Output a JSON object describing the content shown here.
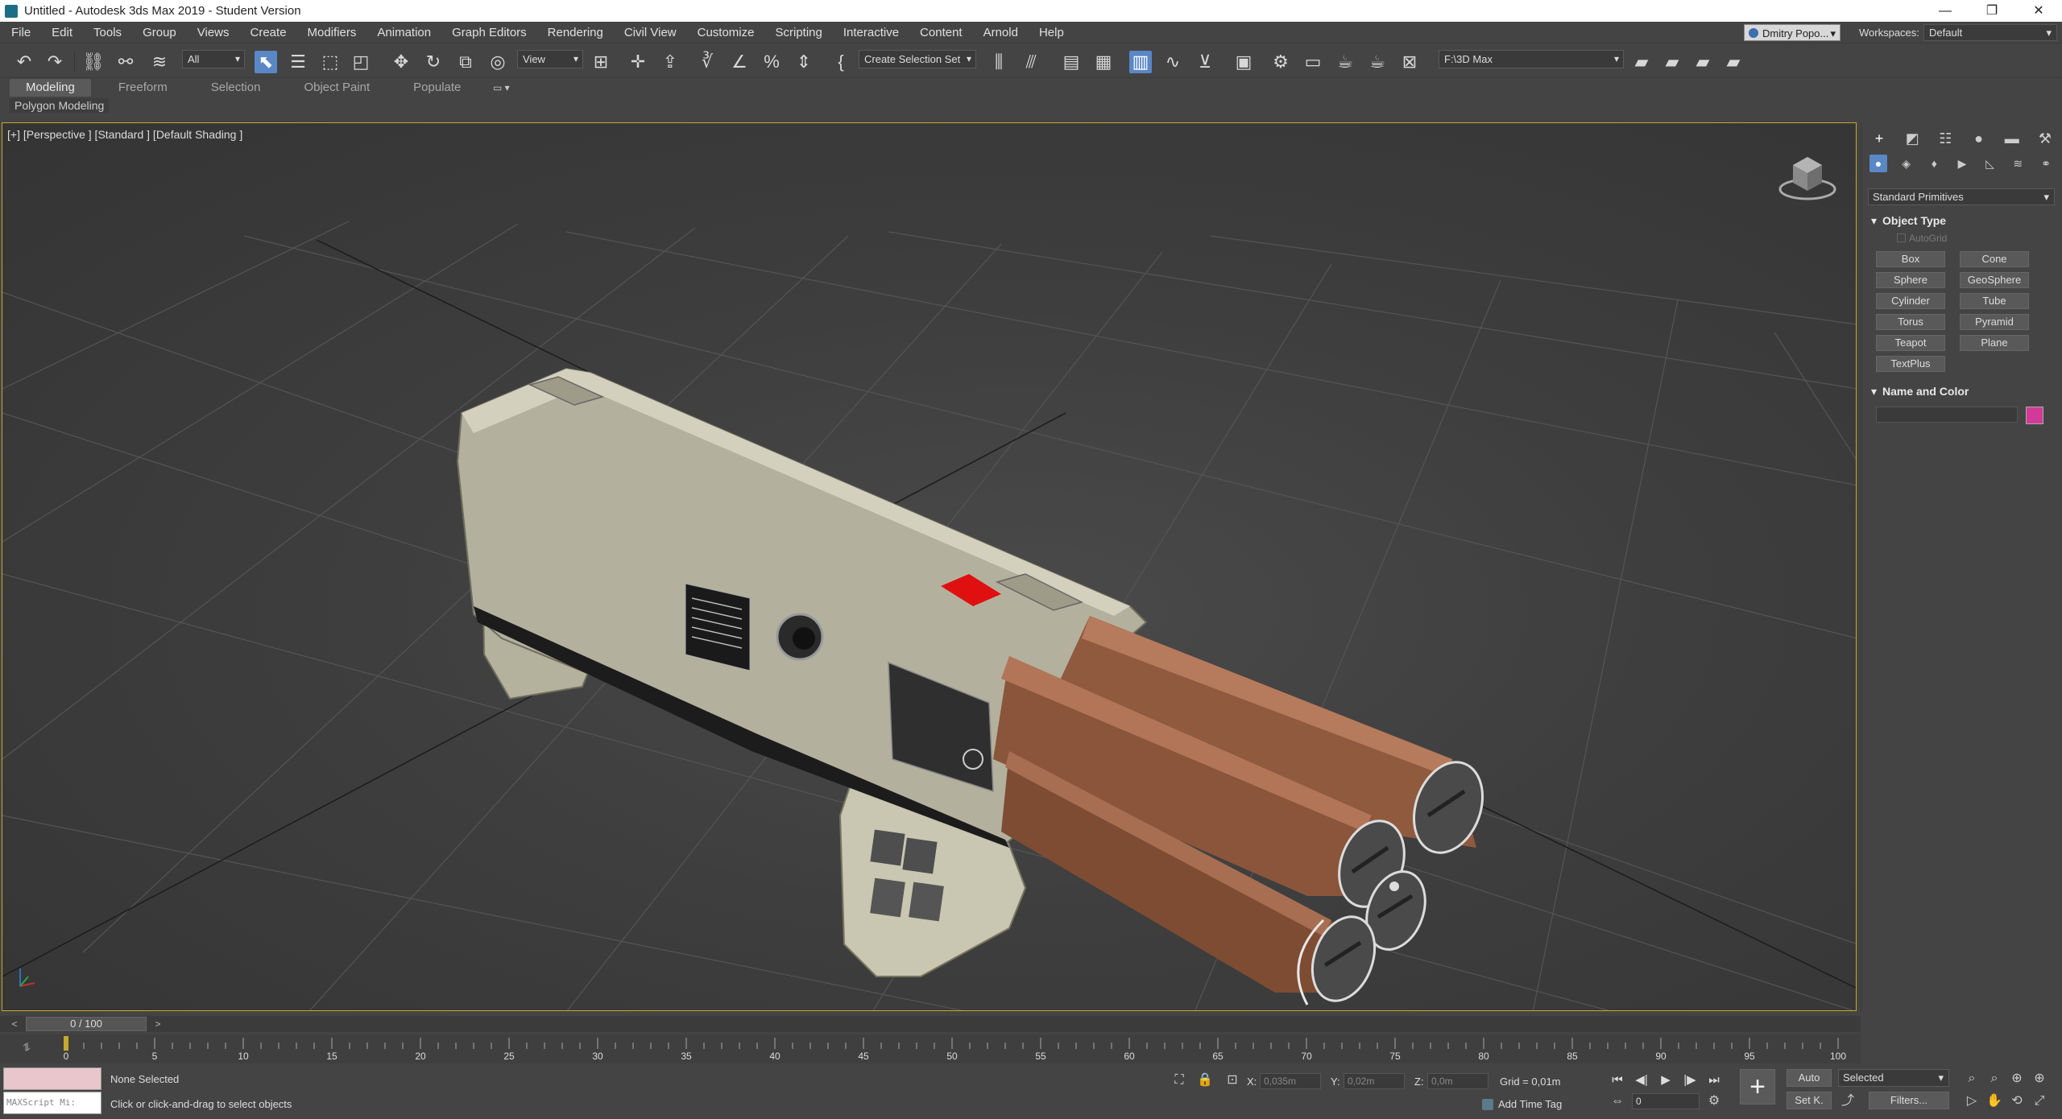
{
  "titlebar": {
    "title": "Untitled - Autodesk 3ds Max 2019 - Student Version",
    "minimize": "—",
    "restore": "❐",
    "close": "✕"
  },
  "menu": [
    "File",
    "Edit",
    "Tools",
    "Group",
    "Views",
    "Create",
    "Modifiers",
    "Animation",
    "Graph Editors",
    "Rendering",
    "Civil View",
    "Customize",
    "Scripting",
    "Interactive",
    "Content",
    "Arnold",
    "Help"
  ],
  "user": {
    "name": "Dmitry Popo..."
  },
  "workspaces": {
    "label": "Workspaces:",
    "value": "Default"
  },
  "toolbar": {
    "filter_value": "All",
    "refcoord_value": "View",
    "selection_set_value": "Create Selection Set",
    "project_path": "F:\\3D Max"
  },
  "ribbon": {
    "tabs": [
      "Modeling",
      "Freeform",
      "Selection",
      "Object Paint",
      "Populate"
    ],
    "panel_label": "Polygon Modeling"
  },
  "viewport": {
    "label": "[+] [Perspective ] [Standard ] [Default Shading ]"
  },
  "command_panel": {
    "category": "Standard Primitives",
    "object_type_title": "Object Type",
    "autogrid_label": "AutoGrid",
    "primitives": [
      "Box",
      "Cone",
      "Sphere",
      "GeoSphere",
      "Cylinder",
      "Tube",
      "Torus",
      "Pyramid",
      "Teapot",
      "Plane",
      "TextPlus"
    ],
    "name_color_title": "Name and Color",
    "object_color": "#d33a98"
  },
  "timeline": {
    "frame_display": "0 / 100",
    "ticks": [
      "0",
      "5",
      "10",
      "15",
      "20",
      "25",
      "30",
      "35",
      "40",
      "45",
      "50",
      "55",
      "60",
      "65",
      "70",
      "75",
      "80",
      "85",
      "90",
      "95",
      "100"
    ]
  },
  "status": {
    "maxscript_placeholder": "MAXScript Mi:",
    "selection_status": "None Selected",
    "prompt": "Click or click-and-drag to select objects",
    "x_label": "X:",
    "x_value": "0,035m",
    "y_label": "Y:",
    "y_value": "0,02m",
    "z_label": "Z:",
    "z_value": "0,0m",
    "grid": "Grid = 0,01m",
    "add_time_tag": "Add Time Tag",
    "auto_key": "Auto",
    "set_key": "Set K.",
    "key_filter": "Selected",
    "filters": "Filters...",
    "current_frame": "0"
  }
}
